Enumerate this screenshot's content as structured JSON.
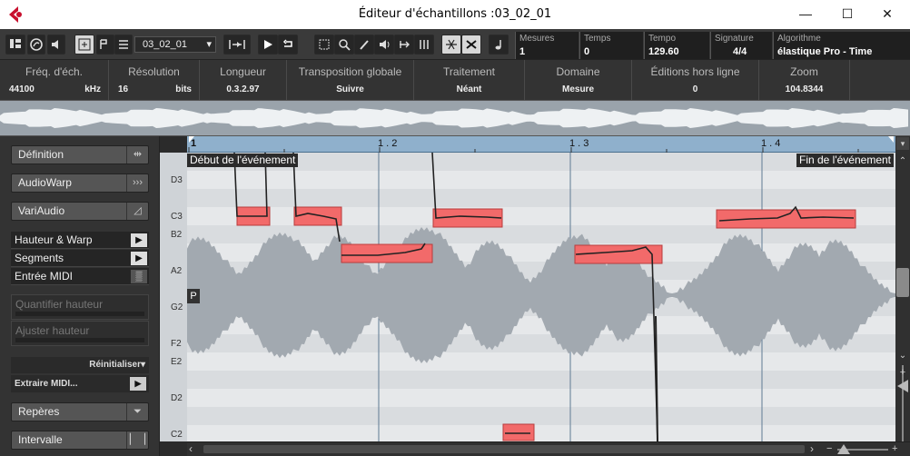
{
  "window": {
    "title": "Éditeur d'échantillons :03_02_01",
    "minimize": "—",
    "maximize": "☐",
    "close": "✕"
  },
  "toolbar": {
    "event_select": "03_02_01",
    "fields": [
      {
        "label": "Mesures",
        "value": "1"
      },
      {
        "label": "Temps",
        "value": "0"
      },
      {
        "label": "Tempo",
        "value": "129.60"
      },
      {
        "label": "Signature",
        "value": "4/4"
      },
      {
        "label": "Algorithme",
        "value": "élastique Pro - Time"
      }
    ]
  },
  "infoline": {
    "columns": [
      {
        "label": "Fréq. d'éch.",
        "value": "44100",
        "unit": "kHz"
      },
      {
        "label": "Résolution",
        "value": "16",
        "unit": "bits"
      },
      {
        "label": "Longueur",
        "value": "0.3.2.97",
        "unit": ""
      },
      {
        "label": "Transposition globale",
        "value": "Suivre",
        "unit": ""
      },
      {
        "label": "Traitement",
        "value": "Néant",
        "unit": ""
      },
      {
        "label": "Domaine",
        "value": "Mesure",
        "unit": ""
      },
      {
        "label": "Éditions hors ligne",
        "value": "0",
        "unit": ""
      },
      {
        "label": "Zoom",
        "value": "104.8344",
        "unit": ""
      }
    ]
  },
  "panel": {
    "sections": [
      "Définition",
      "AudioWarp",
      "VariAudio"
    ],
    "list": [
      "Hauteur & Warp",
      "Segments",
      "Entrée MIDI"
    ],
    "disabled": [
      "Quantifier hauteur",
      "Ajuster hauteur"
    ],
    "reset": "Réinitialiser",
    "extract": "Extraire MIDI...",
    "bottom": [
      "Repères",
      "Intervalle"
    ]
  },
  "editor": {
    "ruler_marks": [
      "1",
      "1 . 2",
      "1 . 3",
      "1 . 4"
    ],
    "event_start": "Début de l'événement",
    "event_end": "Fin de l'événement",
    "pitch_labels": [
      "D3",
      "C3",
      "B2",
      "A2",
      "G2",
      "F2",
      "E2",
      "D2",
      "C2"
    ],
    "p_tag": "P"
  },
  "colors": {
    "segment": "#f26a6a",
    "ruler": "#8fb0cc",
    "waveform": "#a2a9b0"
  }
}
